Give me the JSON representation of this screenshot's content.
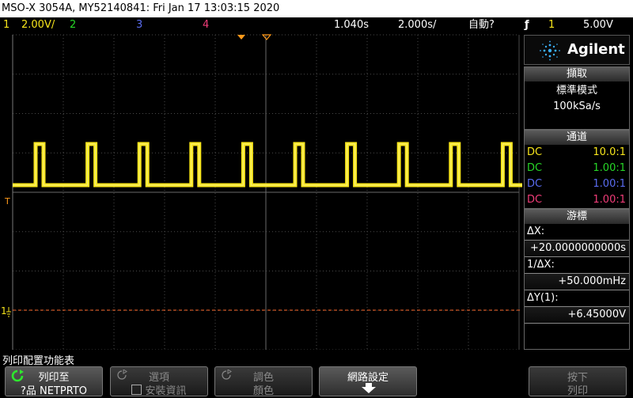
{
  "titlebar": {
    "text": "MSO-X 3054A, MY52140841: Fri Jan 17 13:03:15 2020"
  },
  "status": {
    "ch1_num": "1",
    "ch1_scale": "2.00V/",
    "ch2_num": "2",
    "ch3_num": "3",
    "ch4_num": "4",
    "delay": "1.040s",
    "timebase": "2.000s/",
    "trigger_mode": "自動?",
    "trigger_src": "1",
    "trigger_level": "5.00V"
  },
  "colors": {
    "ch1": "#f7e51b",
    "ch2": "#27d627",
    "ch3": "#5a6cf0",
    "ch4": "#f03c78",
    "grid": "#4a4a4a",
    "trigger": "#ff9a1a"
  },
  "scope": {
    "ch1_marker": "1",
    "trig_marker": "T"
  },
  "panel": {
    "brand": "Agilent",
    "acq": {
      "header": "擷取",
      "mode": "標準模式",
      "rate": "100kSa/s"
    },
    "channels": {
      "header": "通道",
      "rows": [
        {
          "coupling": "DC",
          "probe": "10.0:1"
        },
        {
          "coupling": "DC",
          "probe": "1.00:1"
        },
        {
          "coupling": "DC",
          "probe": "1.00:1"
        },
        {
          "coupling": "DC",
          "probe": "1.00:1"
        }
      ]
    },
    "cursors": {
      "header": "游標",
      "dx_label": "ΔX:",
      "dx_value": "+20.0000000000s",
      "inv_dx_label": "1/ΔX:",
      "inv_dx_value": "+50.000mHz",
      "dy_label": "ΔY(1):",
      "dy_value": "+6.45000V"
    }
  },
  "menu": {
    "title": "列印配置功能表",
    "softkeys": {
      "print_to": {
        "line1": "列印至",
        "line2": "?品 NETPRTO"
      },
      "options": {
        "line1": "選項",
        "line2": "安裝資訊"
      },
      "palette": {
        "line1": "調色",
        "line2": "顏色"
      },
      "network": {
        "line1": "網路設定"
      },
      "press_print": {
        "line1": "按下",
        "line2": "列印"
      }
    }
  }
}
